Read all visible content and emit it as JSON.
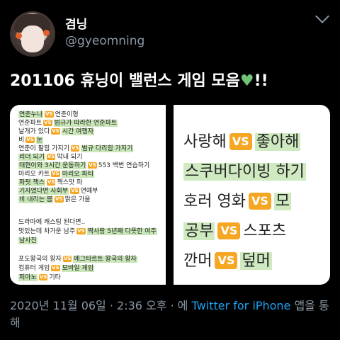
{
  "user": {
    "name": "겸닝",
    "handle": "@gyeomning"
  },
  "tweet": {
    "text": "201106 휴닝이 밸런스 게임 모음",
    "suffix": "!!"
  },
  "left_rows": [
    {
      "a": "연준누나",
      "b": "연준이형"
    },
    {
      "a": "연준파트",
      "b": "범규가 따라한 연준파트"
    },
    {
      "a": "날개가 있다",
      "b": "시간 여행자"
    },
    {
      "a": "비",
      "b": "눈"
    },
    {
      "a": "연준이 팔힘 가지기",
      "b": "범규 다리힘 가지기"
    },
    {
      "a": "리더 되기",
      "b": "막내 되기"
    },
    {
      "a": "태현이와 3시간 운동하기",
      "b": "553 백번 연습하기"
    },
    {
      "a": "마리오 카트",
      "b": "마리오 파티"
    },
    {
      "a": "파핏 책스",
      "b": "첵스맛 파"
    },
    {
      "a": "기자였다면 사회부",
      "b": "연예부"
    },
    {
      "a": "비 내리는 봄",
      "b": "맑은 가을"
    }
  ],
  "left_text": {
    "t1": "드라마에 캐스팅 된다면..",
    "t2a": "멋있는데 차가운 남주",
    "t2b": "짝사랑 5년째 다뜻한 여주",
    "t3": "남사친",
    "p1a": "포도왕국의 왕자",
    "p1b": "에그타르트 왕국의 왕자",
    "p2a": "컴퓨터 게임",
    "p2b": "모바일 게임",
    "p3a": "피아노",
    "p3b": "기타"
  },
  "vs_label": "VS",
  "right_rows": [
    {
      "a": "사랑해",
      "b": "좋아해"
    },
    {
      "a": "스쿠버다이빙 하기",
      "b": ""
    },
    {
      "a": "호러 영화",
      "b": "모"
    },
    {
      "a": "공부",
      "b": "스포츠"
    },
    {
      "a": "깐머",
      "b": "덮머"
    }
  ],
  "meta": {
    "date": "2020년 11월 06일 · 2:36 오후 · 에 ",
    "via": "Twitter for iPhone",
    "suffix": " 앱을 통해"
  },
  "colors": {
    "accent": "#1da1f2",
    "vs": "#f5a623",
    "highlight": "#c9e7b8"
  }
}
